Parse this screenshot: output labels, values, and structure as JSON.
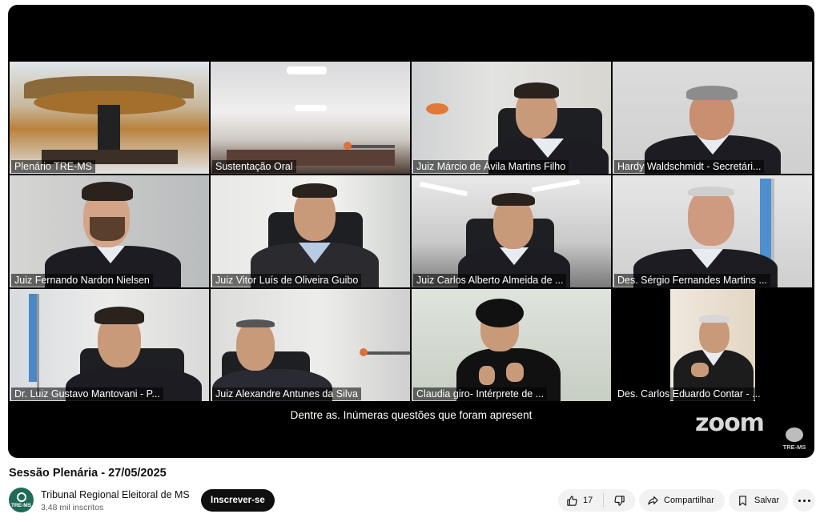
{
  "player": {
    "tiles": [
      {
        "name": "Plenário TRE-MS",
        "active": true
      },
      {
        "name": "Sustentação Oral"
      },
      {
        "name": "Juiz Márcio de Ávila Martins Filho"
      },
      {
        "name": "Hardy Waldschmidt - Secretári..."
      },
      {
        "name": "Juiz Fernando Nardon Nielsen"
      },
      {
        "name": "Juiz Vitor Luís de Oliveira Guibo"
      },
      {
        "name": "Juiz Carlos Alberto Almeida de ..."
      },
      {
        "name": "Des. Sérgio Fernandes Martins ..."
      },
      {
        "name": "Dr. Luiz Gustavo Mantovani - P..."
      },
      {
        "name": "Juiz Alexandre Antunes da Silva"
      },
      {
        "name": "Claudia giro- Intérprete de ..."
      },
      {
        "name": "Des. Carlos Eduardo Contar - ..."
      }
    ],
    "caption": "Dentre as. Inúmeras questões que foram apresent",
    "zoom_logo": "zoom",
    "watermark": "TRE-MS"
  },
  "video": {
    "title": "Sessão Plenária - 27/05/2025"
  },
  "channel": {
    "avatar_text": "TRE-MS",
    "name": "Tribunal Regional Eleitoral de MS",
    "subscribers": "3,48 mil inscritos",
    "subscribe_label": "Inscrever-se"
  },
  "actions": {
    "likes": "17",
    "share_label": "Compartilhar",
    "save_label": "Salvar"
  },
  "colors": {
    "active_speaker_border": "#7ed321",
    "channel_avatar": "#1f6b58"
  },
  "icons": [
    "thumbs-up-icon",
    "thumbs-down-icon",
    "share-icon",
    "bookmark-icon",
    "more-icon"
  ]
}
